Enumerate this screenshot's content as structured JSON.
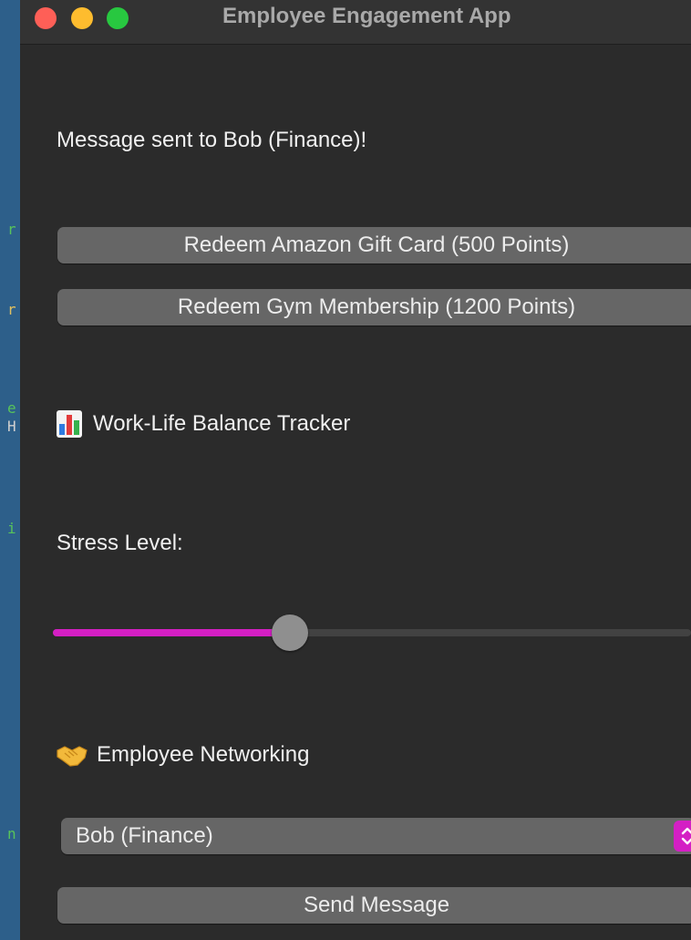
{
  "window": {
    "title": "Employee Engagement App"
  },
  "status": {
    "message": "Message sent to Bob (Finance)!"
  },
  "rewards": {
    "gift_card_label": "Redeem Amazon Gift Card (500 Points)",
    "gym_label": "Redeem Gym Membership (1200 Points)"
  },
  "tracker": {
    "icon": "bar-chart-icon",
    "heading": "Work-Life Balance Tracker",
    "stress_label": "Stress Level:",
    "stress_level_fraction": 0.4
  },
  "networking": {
    "icon": "handshake-icon",
    "heading": "Employee Networking",
    "selected_employee": "Bob (Finance)",
    "send_label": "Send Message"
  },
  "colors": {
    "accent": "#d41fc4",
    "button": "#666666",
    "background": "#2b2b2b"
  }
}
